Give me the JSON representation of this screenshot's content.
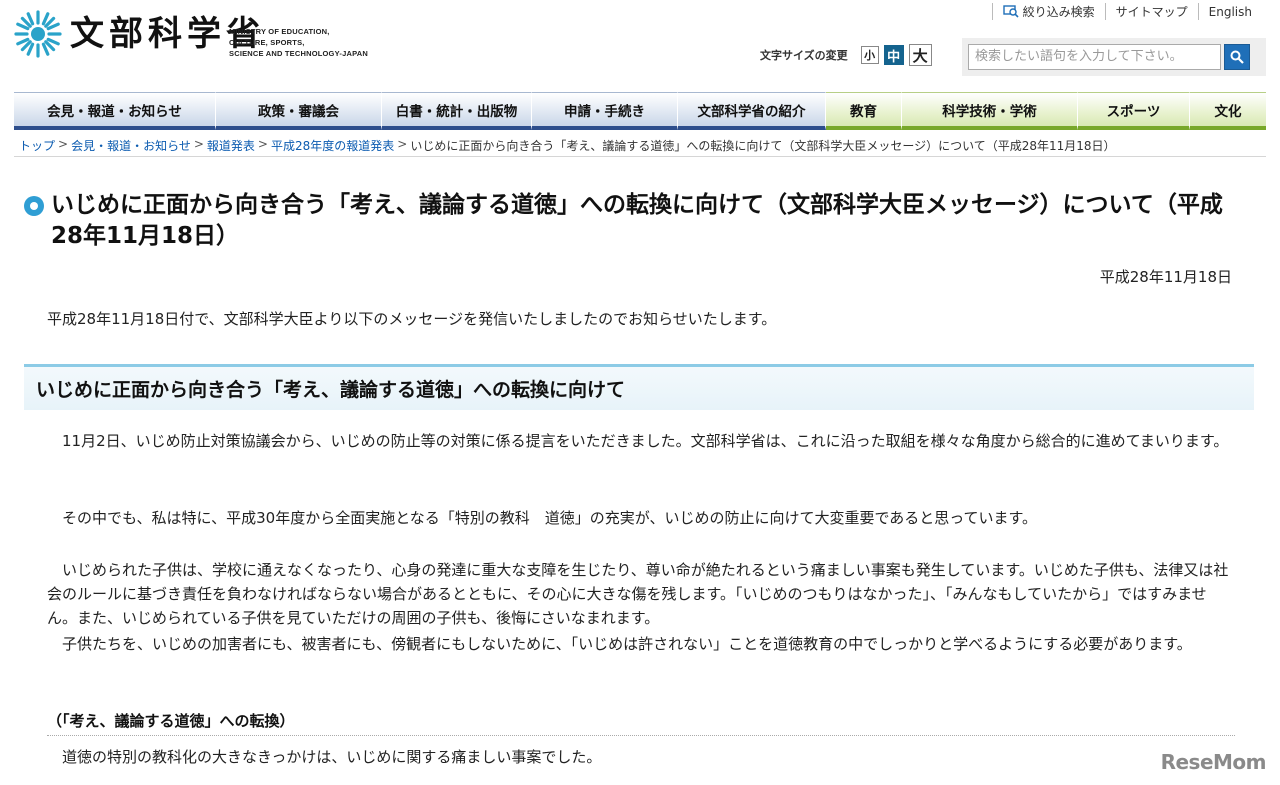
{
  "header": {
    "logo_jp": "文部科学省",
    "logo_en": [
      "MINISTRY OF EDUCATION,",
      "CULTURE, SPORTS,",
      "SCIENCE AND TECHNOLOGY-JAPAN"
    ],
    "util_links": [
      "絞り込み検索",
      "サイトマップ",
      "English"
    ],
    "fontsize_label": "文字サイズの変更",
    "fontsize_small": "小",
    "fontsize_medium": "中",
    "fontsize_large": "大",
    "search_placeholder": "検索したい語句を入力して下さい。"
  },
  "nav": [
    {
      "label": "会見・報道・お知らせ",
      "group": "blue"
    },
    {
      "label": "政策・審議会",
      "group": "blue"
    },
    {
      "label": "白書・統計・出版物",
      "group": "blue"
    },
    {
      "label": "申請・手続き",
      "group": "blue"
    },
    {
      "label": "文部科学省の紹介",
      "group": "blue"
    },
    {
      "label": "教育",
      "group": "green"
    },
    {
      "label": "科学技術・学術",
      "group": "green"
    },
    {
      "label": "スポーツ",
      "group": "green"
    },
    {
      "label": "文化",
      "group": "green"
    }
  ],
  "breadcrumb": {
    "links": [
      "トップ",
      "会見・報道・お知らせ",
      "報道発表",
      "平成28年度の報道発表"
    ],
    "current": "いじめに正面から向き合う「考え、議論する道徳」への転換に向けて（文部科学大臣メッセージ）について（平成28年11月18日）"
  },
  "page": {
    "title": "いじめに正面から向き合う「考え、議論する道徳」への転換に向けて（文部科学大臣メッセージ）について（平成28年11月18日）",
    "date": "平成28年11月18日",
    "intro": "平成28年11月18日付で、文部科学大臣より以下のメッセージを発信いたしましたのでお知らせいたします。",
    "section_heading": "いじめに正面から向き合う「考え、議論する道徳」への転換に向けて",
    "p1": "　11月2日、いじめ防止対策協議会から、いじめの防止等の対策に係る提言をいただきました。文部科学省は、これに沿った取組を様々な角度から総合的に進めてまいります。",
    "p2": "　その中でも、私は特に、平成30年度から全面実施となる「特別の教科　道徳」の充実が、いじめの防止に向けて大変重要であると思っています。",
    "p3": "　いじめられた子供は、学校に通えなくなったり、心身の発達に重大な支障を生じたり、尊い命が絶たれるという痛ましい事案も発生しています。いじめた子供も、法律又は社会のルールに基づき責任を負わなければならない場合があるとともに、その心に大きな傷を残します。「いじめのつもりはなかった」、「みんなもしていたから」ではすみません。また、いじめられている子供を見ていただけの周囲の子供も、後悔にさいなまれます。",
    "p4": "　子供たちを、いじめの加害者にも、被害者にも、傍観者にもしないために、「いじめは許されない」ことを道徳教育の中でしっかりと学べるようにする必要があります。",
    "subhead": "（「考え、議論する道徳」への転換）",
    "p5": "　道徳の特別の教科化の大きなきっかけは、いじめに関する痛ましい事案でした。"
  },
  "watermark": "ReseMom",
  "colors": {
    "link": "#0b5bb0",
    "nav_blue_border": "#2d4e8c",
    "nav_green_border": "#78a82a",
    "accent": "#2f9ed4",
    "fontsize_active": "#14638e"
  }
}
